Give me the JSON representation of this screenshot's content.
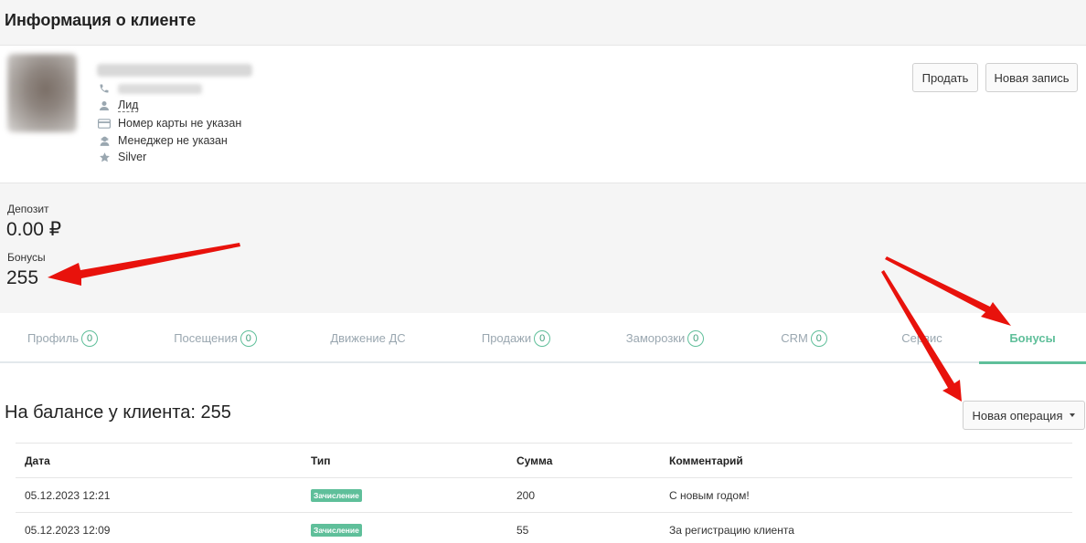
{
  "header": {
    "title": "Информация о клиенте"
  },
  "client": {
    "status": "Лид",
    "card": "Номер карты не указан",
    "manager": "Менеджер не указан",
    "level": "Silver"
  },
  "actions": {
    "sell_label": "Продать",
    "new_record_label": "Новая запись"
  },
  "balance": {
    "deposit_label": "Депозит",
    "deposit_value": "0.00 ₽",
    "bonus_label": "Бонусы",
    "bonus_value": "255"
  },
  "tabs": [
    {
      "label": "Профиль",
      "count": "0"
    },
    {
      "label": "Посещения",
      "count": "0"
    },
    {
      "label": "Движение ДС"
    },
    {
      "label": "Продажи",
      "count": "0"
    },
    {
      "label": "Заморозки",
      "count": "0"
    },
    {
      "label": "CRM",
      "count": "0"
    },
    {
      "label": "Сервис"
    },
    {
      "label": "Бонусы"
    }
  ],
  "bonuses": {
    "title": "На балансе у клиента: 255",
    "new_operation_label": "Новая операция",
    "columns": [
      "Дата",
      "Тип",
      "Сумма",
      "Комментарий"
    ],
    "rows": [
      {
        "date": "05.12.2023 12:21",
        "type": "Зачисление",
        "amount": "200",
        "comment": "С новым годом!"
      },
      {
        "date": "05.12.2023 12:09",
        "type": "Зачисление",
        "amount": "55",
        "comment": "За регистрацию клиента"
      }
    ]
  },
  "colors": {
    "accent": "#5fbf9a",
    "arrow": "#e8120c",
    "tab_inactive": "#9aa7b0"
  },
  "icons": [
    "phone-icon",
    "user-icon",
    "card-icon",
    "manager-icon",
    "star-icon",
    "caret-down-icon"
  ]
}
